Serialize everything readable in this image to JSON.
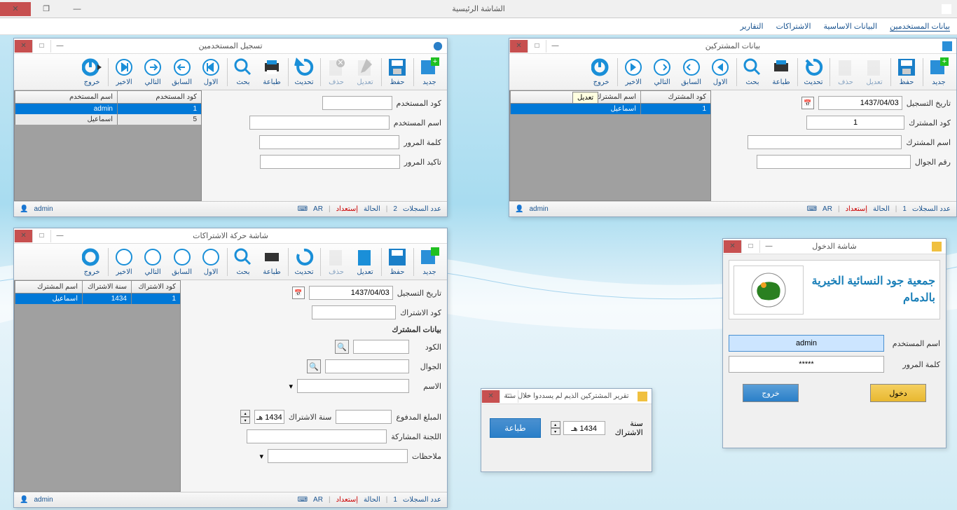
{
  "main": {
    "title": "الشاشة الرئيسية",
    "menu": [
      "بيانات المستخدمين",
      "البيانات الاساسية",
      "الاشتراكات",
      "التقارير"
    ]
  },
  "toolbar": {
    "new": "جديد",
    "save": "حفظ",
    "edit": "تعديل",
    "delete": "حذف",
    "refresh": "تحديث",
    "print": "طباعة",
    "search": "بحث",
    "first": "الاول",
    "prev": "السابق",
    "next": "التالي",
    "last": "الاخير",
    "exit": "خروج"
  },
  "status": {
    "records": "عدد السجلات",
    "state": "الحالة",
    "ready": "إستعداد",
    "lang": "AR",
    "user": "admin"
  },
  "users_win": {
    "title": "تسجيل المستخدمين",
    "f_code": "كود المستخدم",
    "f_name": "اسم  المستخدم",
    "f_pass": "كلمة المرور",
    "f_confirm": "تاكيد المرور",
    "col_code": "كود المستخدم",
    "col_name": "اسم المستخدم",
    "rows": [
      {
        "code": "1",
        "name": "admin"
      },
      {
        "code": "5",
        "name": "اسماعيل"
      }
    ],
    "count": "2"
  },
  "subs_win": {
    "title": "بيانات المشتركين",
    "f_date": "تاريخ التسجيل",
    "f_code": "كود المشترك",
    "f_name": "اسم  المشترك",
    "f_phone": "رقم الجوال",
    "date_val": "1437/04/03",
    "code_val": "1",
    "col_code": "كود المشترك",
    "col_name": "اسم المشترك",
    "rows": [
      {
        "code": "1",
        "name": "اسماعيل"
      }
    ],
    "count": "1",
    "tooltip": "تعديل"
  },
  "mov_win": {
    "title": "شاشة حركة الاشتراكات",
    "f_date": "تاريخ التسجيل",
    "f_code": "كود الاشتراك",
    "date_val": "1437/04/03",
    "sec_label": "بيانات المشترك",
    "f_scode": "الكود",
    "f_phone": "الجوال",
    "f_name": "الاسم",
    "f_paid": "المبلغ المدفوع",
    "f_year": "سنة الاشتراك",
    "year_val": "1434 هـ",
    "f_comm": "اللجنة المشاركة",
    "f_notes": "ملاحظات",
    "col_code": "كود الاشتراك",
    "col_year": "سنة الاشتراك",
    "col_name": "اسم المشترك",
    "rows": [
      {
        "code": "1",
        "year": "1434",
        "name": "اسماعيل"
      }
    ],
    "count": "1"
  },
  "login_win": {
    "title": "شاشة الدخول",
    "org": "جمعية جود النسائية الخيرية بالدمام",
    "f_user": "اسم  المستخدم",
    "f_pass": "كلمة المرور",
    "user_val": "admin",
    "pass_val": "*****",
    "btn_enter": "دخول",
    "btn_exit": "خروج"
  },
  "report_win": {
    "title": "تقرير المشتركين الذيم لم يسددوا خلال سنة",
    "f_year": "سنة الاشتراك",
    "year_val": "1434 هـ",
    "btn_print": "طباعة"
  }
}
